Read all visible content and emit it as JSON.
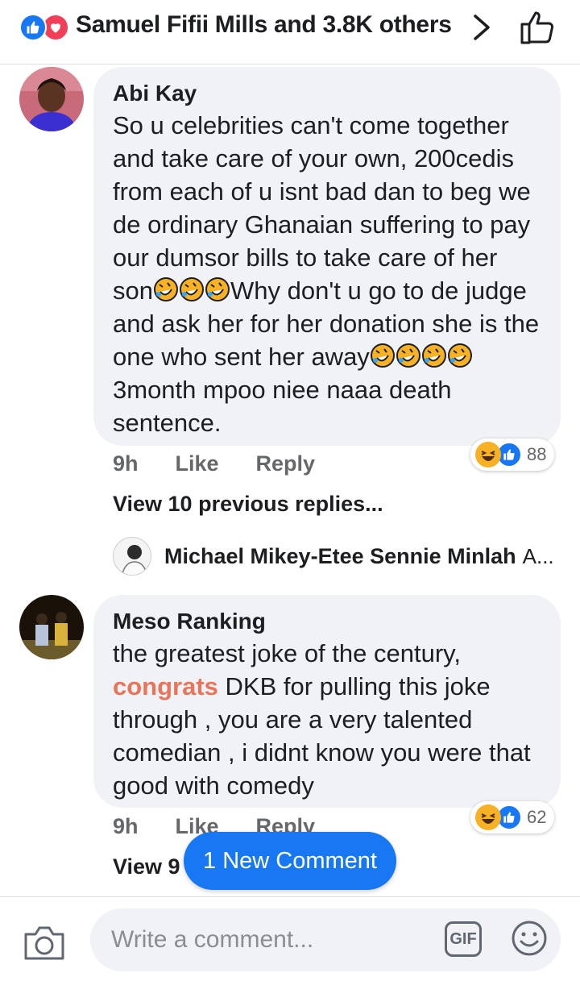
{
  "header": {
    "title": "Samuel Fifii Mills and 3.8K others",
    "reaction_icons": [
      "like-icon",
      "love-icon"
    ]
  },
  "comments": [
    {
      "author": "Abi Kay",
      "text_parts": [
        "So u celebrities can't come together and take care of your own, 200cedis from each of u isnt bad dan to beg we de ordinary Ghanaian suffering to pay our dumsor bills to take care of her son",
        "Why don't u go to de judge and ask her for her donation she is the one who sent her away",
        "3month mpoo niee naaa death sentence."
      ],
      "time": "9h",
      "like_label": "Like",
      "reply_label": "Reply",
      "reaction_count": "88",
      "view_replies": "View 10 previous replies..."
    },
    {
      "author": "Meso Ranking",
      "text_before_tag": "the greatest joke of the century,",
      "tag": "congrats",
      "text_after_tag": " DKB for pulling this joke through , you are a very talented comedian , i didnt know you were that good with comedy",
      "time": "9h",
      "like_label": "Like",
      "reply_label": "Reply",
      "reaction_count": "62",
      "view_replies": "View 9"
    }
  ],
  "reply_preview": {
    "name": "Michael Mikey-Etee Sennie Minlah",
    "text": "A..."
  },
  "new_comment_pill": "1 New Comment",
  "composer": {
    "placeholder": "Write a comment...",
    "gif_label": "GIF"
  },
  "colors": {
    "accent": "#1877f2",
    "love": "#f33e58",
    "haha": "#f7b125",
    "tag": "#e8745a",
    "bubble": "#f0f2f5"
  }
}
